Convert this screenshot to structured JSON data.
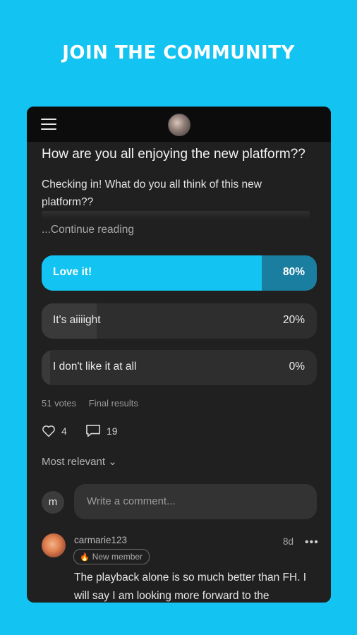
{
  "promo": {
    "headline": "JOIN THE COMMUNITY"
  },
  "post": {
    "title": "How are you all enjoying the new platform??",
    "body": "Checking in! What do you all think of this new platform??",
    "continue_label": "...Continue reading"
  },
  "poll": {
    "options": [
      {
        "label": "Love it!",
        "percent_label": "80%",
        "percent": 80
      },
      {
        "label": "It's aiiiight",
        "percent_label": "20%",
        "percent": 20
      },
      {
        "label": "I don't like it at all",
        "percent_label": "0%",
        "percent": 0
      }
    ],
    "votes": "51 votes",
    "status": "Final results"
  },
  "reactions": {
    "likes": "4",
    "comments": "19"
  },
  "sort_label": "Most relevant",
  "composer": {
    "avatar_letter": "m",
    "placeholder": "Write a comment..."
  },
  "comment": {
    "username": "carmarie123",
    "badge": "New member",
    "age": "8d",
    "text": "The playback alone is so much better than FH. I will say I am looking more forward to the"
  },
  "colors": {
    "accent": "#13c3f1",
    "poll_track_selected": "#1a7ea1",
    "card": "#202020"
  },
  "icons": [
    "menu-icon",
    "heart-icon",
    "comment-icon",
    "chevron-down-icon",
    "fire-icon",
    "more-icon"
  ]
}
